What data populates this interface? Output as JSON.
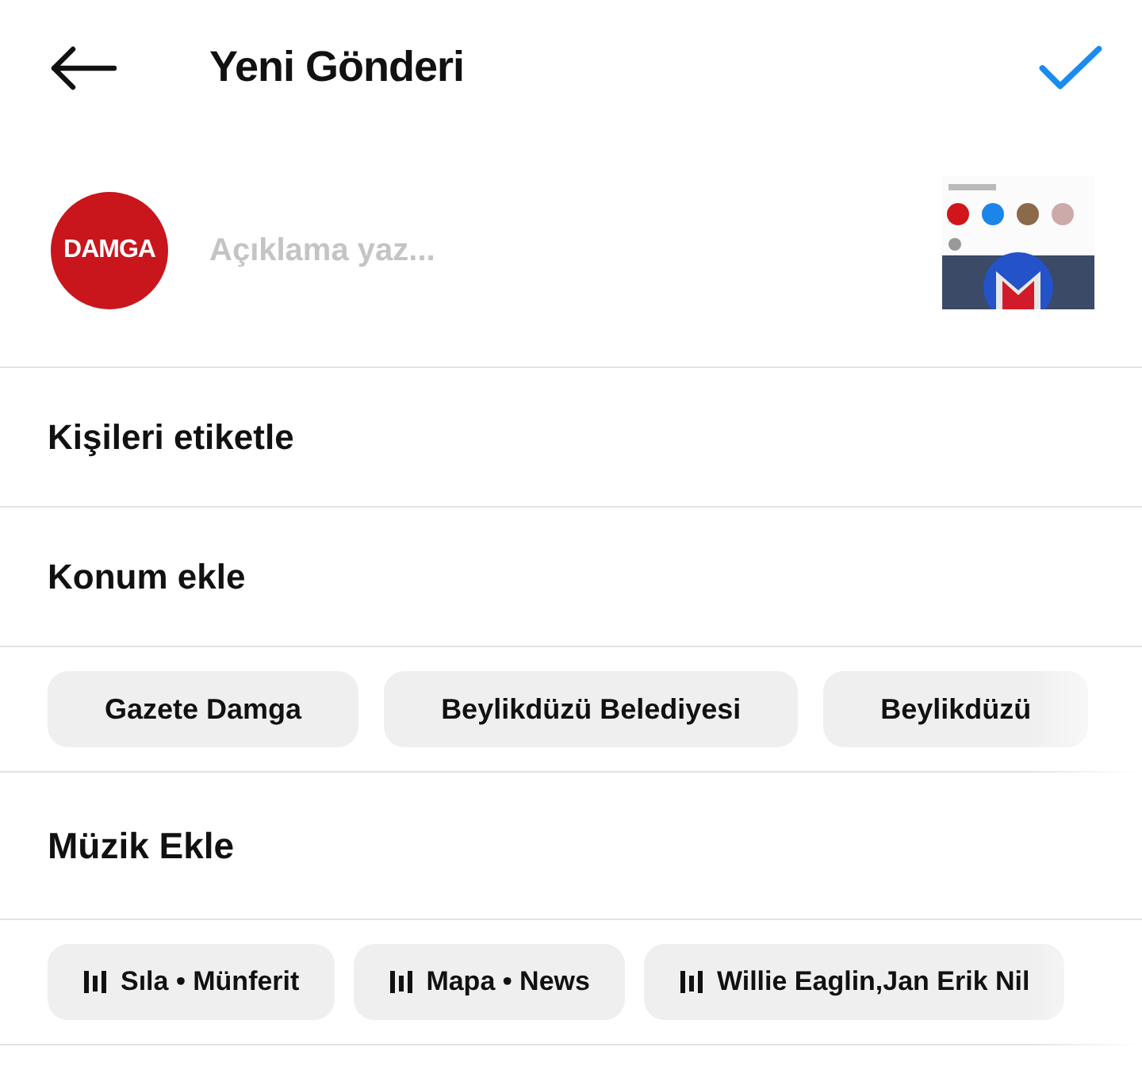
{
  "header": {
    "title": "Yeni Gönderi"
  },
  "caption": {
    "avatar_text": "DAMGA",
    "placeholder": "Açıklama yaz..."
  },
  "options": [
    {
      "label": "Kişileri etiketle"
    },
    {
      "label": "Konum ekle"
    }
  ],
  "location_suggestions": [
    "Gazete Damga",
    "Beylikdüzü Belediyesi",
    "Beylikdüzü"
  ],
  "music": {
    "label": "Müzik Ekle"
  },
  "music_suggestions": [
    "Sıla • Münferit",
    "Mapa • News",
    "Willie Eaglin,Jan Erik Nil"
  ]
}
